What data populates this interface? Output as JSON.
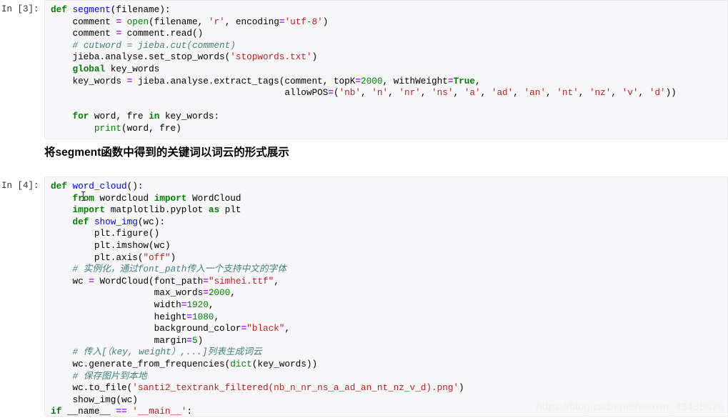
{
  "notebook": {
    "watermark": "https://blog.csdn.net/weixin_43435675",
    "cells": [
      {
        "type": "code",
        "prompt": "In [3]:",
        "lines": [
          "def segment(filename):",
          "    comment = open(filename, 'r', encoding='utf-8')",
          "    comment = comment.read()",
          "    # cutword = jieba.cut(comment)",
          "    jieba.analyse.set_stop_words('stopwords.txt')",
          "    global key_words",
          "    key_words = jieba.analyse.extract_tags(comment, topK=2000, withWeight=True,",
          "                                           allowPOS=('nb', 'n', 'nr', 'ns', 'a', 'ad', 'an', 'nt', 'nz', 'v', 'd'))",
          "",
          "    for word, fre in key_words:",
          "        print(word, fre)"
        ]
      },
      {
        "type": "markdown",
        "heading": "将segment函数中得到的关键词以词云的形式展示"
      },
      {
        "type": "code",
        "prompt": "In [4]:",
        "lines": [
          "def word_cloud():",
          "    from wordcloud import WordCloud",
          "    import matplotlib.pyplot as plt",
          "    def show_img(wc):",
          "        plt.figure()",
          "        plt.imshow(wc)",
          "        plt.axis(\"off\")",
          "    # 实例化，通过font_path传入一个支持中文的字体",
          "    wc = WordCloud(font_path=\"simhei.ttf\",",
          "                   max_words=2000,",
          "                   width=1920,",
          "                   height=1080,",
          "                   background_color=\"black\",",
          "                   margin=5)",
          "    # 传入[（key, weight）,...]列表生成词云",
          "    wc.generate_from_frequencies(dict(key_words))",
          "    # 保存图片到本地",
          "    wc.to_file('santi2_textrank_filtered(nb_n_nr_ns_a_ad_an_nt_nz_v_d).png')",
          "    show_img(wc)",
          "if __name__ == '__main__':"
        ]
      }
    ],
    "colors": {
      "keyword": "#008000",
      "function": "#0000ff",
      "string": "#ba2121",
      "number": "#008000",
      "operator": "#aa22ff",
      "comment": "#408080",
      "cell_background": "#f7f7f9",
      "cell_border": "#e8e8ef",
      "watermark": "#efefef"
    }
  }
}
